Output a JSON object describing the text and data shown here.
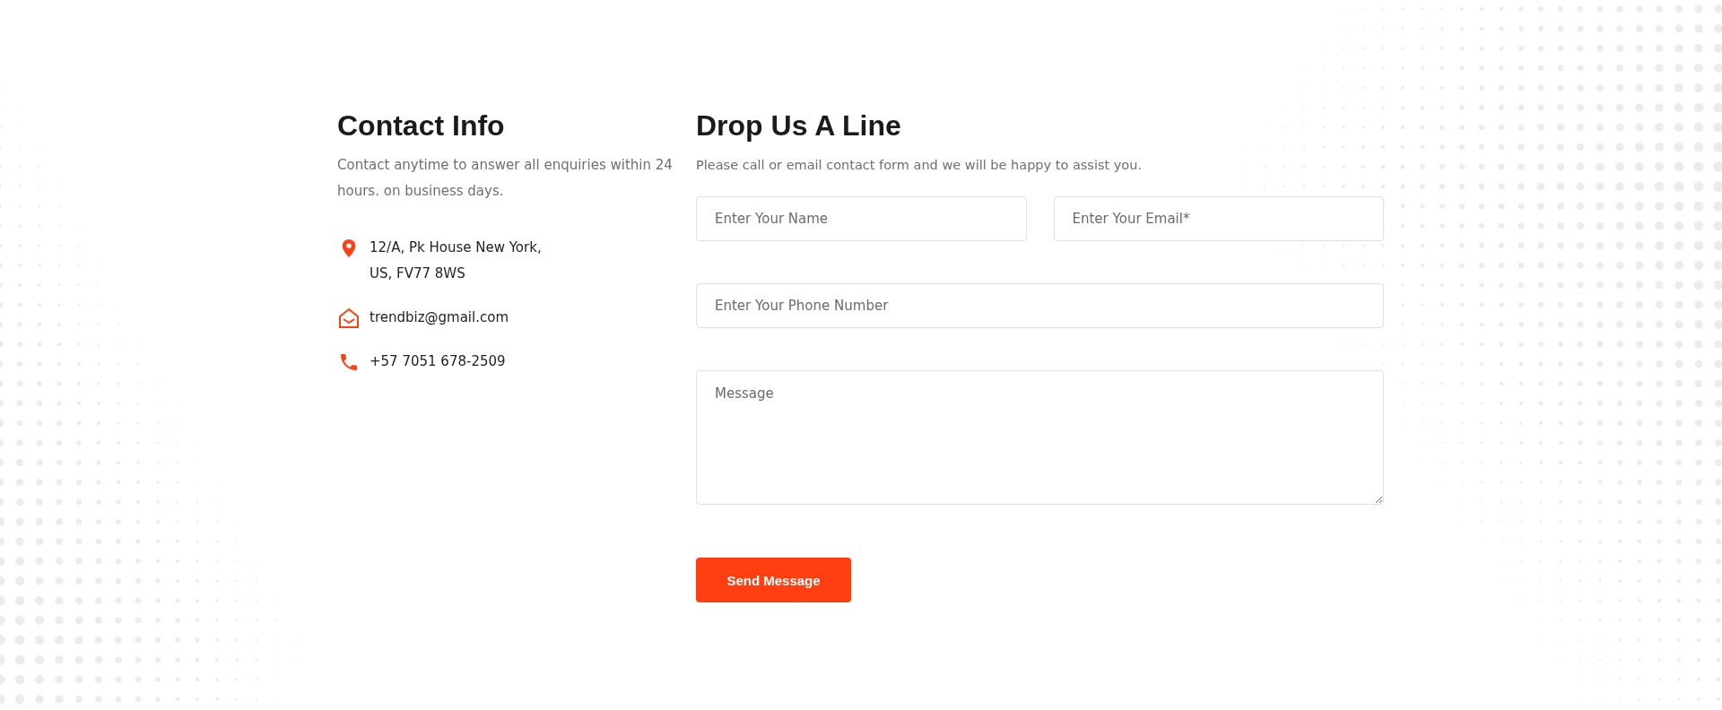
{
  "contact_info": {
    "title": "Contact Info",
    "description": "Contact anytime to answer all enquiries within 24 hours. on business days.",
    "items": [
      {
        "kind": "location",
        "lines": [
          "12/A, Pk House New York,",
          "US, FV77 8WS"
        ]
      },
      {
        "kind": "email",
        "lines": [
          "trendbiz@gmail.com"
        ]
      },
      {
        "kind": "phone",
        "lines": [
          "+57 7051 678-2509"
        ]
      }
    ]
  },
  "form": {
    "title": "Drop Us A Line",
    "description": "Please call or email contact form and we will be happy to assist you.",
    "fields": [
      {
        "kind": "input",
        "placeholder": "Enter Your Name",
        "half": true
      },
      {
        "kind": "input",
        "placeholder": "Enter Your Email*",
        "half": true
      },
      {
        "kind": "input",
        "placeholder": "Enter Your Phone Number",
        "half": false
      },
      {
        "kind": "textarea",
        "placeholder": "Message",
        "half": false
      }
    ],
    "button": "Send Message"
  }
}
